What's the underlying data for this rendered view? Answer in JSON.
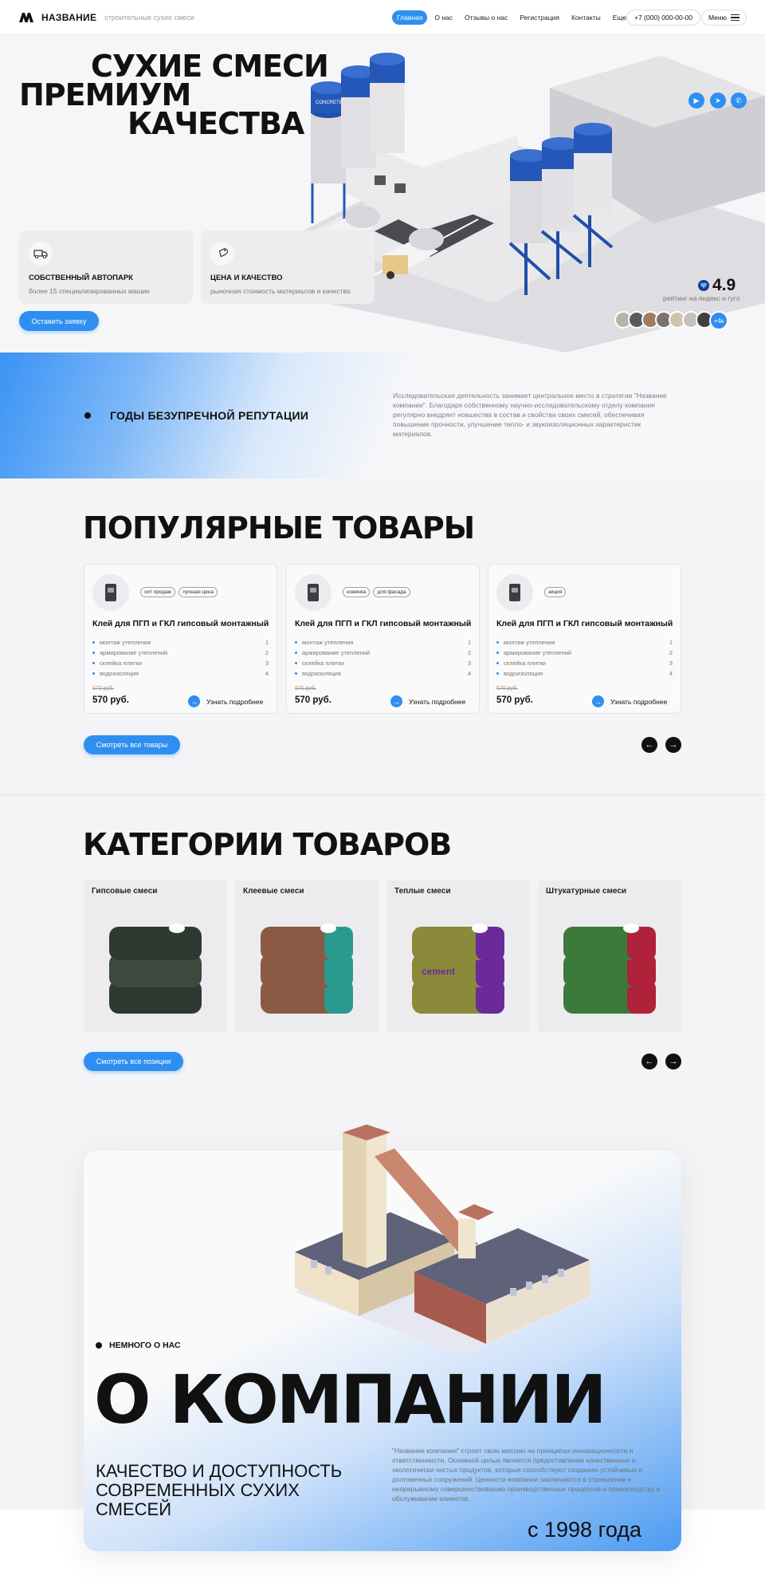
{
  "header": {
    "logo_name": "НАЗВАНИЕ",
    "logo_sub": "строительные сухие смеси",
    "nav": [
      "Главная",
      "О нас",
      "Отзывы о нас",
      "Регистрация",
      "Контакты",
      "Еще"
    ],
    "phone": "+7 (000) 000-00-00",
    "menu_label": "Меню"
  },
  "hero": {
    "title_lines": [
      "СУХИЕ СМЕСИ",
      "ПРЕМИУМ",
      "КАЧЕСТВА"
    ],
    "features": [
      {
        "title": "СОБСТВЕННЫЙ АВТОПАРК",
        "text": "более 15 специализированных машин",
        "icon": "truck-icon"
      },
      {
        "title": "ЦЕНА И КАЧЕСТВО",
        "text": "рыночная стоимость материалов и качество",
        "icon": "tag-icon"
      }
    ],
    "cta_label": "Оставить заявку",
    "rating": "4.9",
    "rating_sub": "рейтинг на яндекс и гугл",
    "avatars_more": "+4к",
    "silo_label": "CONCRETE"
  },
  "reputation": {
    "title": "ГОДЫ БЕЗУПРЕЧНОЙ РЕПУТАЦИИ",
    "text": "Исследовательская деятельность занимает центральное место в стратегии \"Название компании\". Благодаря собственному научно-исследовательскому отделу компания регулярно внедряет новшества в состав и свойства своих смесей, обеспечивая повышение прочности, улучшение тепло- и звукоизоляционных характеристик материалов."
  },
  "popular": {
    "title": "ПОПУЛЯРНЫЕ ТОВАРЫ",
    "products": [
      {
        "tags": [
          "хит продаж",
          "лучшая цена"
        ],
        "name": "Клей для ПГП и ГКЛ гипсовый монтажный",
        "features": [
          [
            "монтаж утепления",
            "1"
          ],
          [
            "армирование утеплений",
            "2"
          ],
          [
            "склейка плитки",
            "3"
          ],
          [
            "водоизоляция",
            "4"
          ]
        ],
        "old_price": "570 руб.",
        "price": "570 руб.",
        "more": "Узнать подробнее"
      },
      {
        "tags": [
          "новинка",
          "для фасада"
        ],
        "name": "Клей для ПГП и ГКЛ гипсовый монтажный",
        "features": [
          [
            "монтаж утепления",
            "1"
          ],
          [
            "армирование утеплений",
            "2"
          ],
          [
            "склейка плитки",
            "3"
          ],
          [
            "водоизоляция",
            "4"
          ]
        ],
        "old_price": "570 руб.",
        "price": "570 руб.",
        "more": "Узнать подробнее"
      },
      {
        "tags": [
          "акция"
        ],
        "name": "Клей для ПГП и ГКЛ гипсовый монтажный",
        "features": [
          [
            "монтаж утепления",
            "1"
          ],
          [
            "армирование утеплений",
            "2"
          ],
          [
            "склейка плитки",
            "3"
          ],
          [
            "водоизоляция",
            "4"
          ]
        ],
        "old_price": "570 руб.",
        "price": "570 руб.",
        "more": "Узнать подробнее"
      }
    ],
    "all_label": "Смотреть все товары"
  },
  "categories": {
    "title": "КАТЕГОРИИ ТОВАРОВ",
    "items": [
      {
        "label": "Гипсовые смеси",
        "color_a": "#3c4a40",
        "color_b": "#2d3a31"
      },
      {
        "label": "Клеевые смеси",
        "color_a": "#2a9a8f",
        "color_b": "#8a5a45"
      },
      {
        "label": "Теплые смеси",
        "color_a": "#6a2a9a",
        "color_b": "#8a8a3a"
      },
      {
        "label": "Штукатурные смеси",
        "color_a": "#b0223a",
        "color_b": "#3c7a3a"
      }
    ],
    "bag_text": "cement",
    "all_label": "Смотреть все позиции"
  },
  "about": {
    "kicker": "НЕМНОГО О НАС",
    "title": "О КОМПАНИИ",
    "text": "\"Название компании\" строит свою миссию на принципах инновационности и ответственности. Основной целью является предоставление качественных и экологически чистых продуктов, которые способствуют созданию устойчивых и долговечных сооружений. Ценности компании заключаются в стремлении к непрерывному совершенствованию производственных процессов и превосходству в обслуживании клиентов.",
    "subtitle": "КАЧЕСТВО И ДОСТУПНОСТЬ СОВРЕМЕННЫХ СУХИХ СМЕСЕЙ",
    "since": "с 1998 года"
  },
  "colors": {
    "accent": "#2f8ff0",
    "dark": "#111111"
  }
}
